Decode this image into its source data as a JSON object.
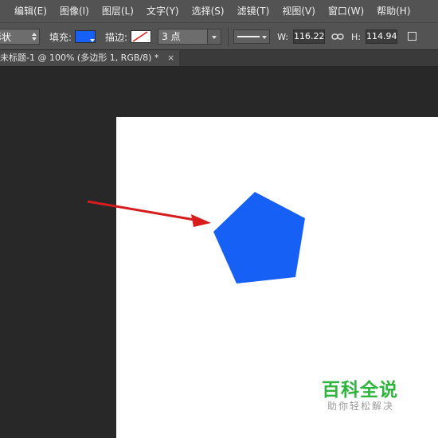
{
  "menu": {
    "items": [
      {
        "label": "编辑(E)"
      },
      {
        "label": "图像(I)"
      },
      {
        "label": "图层(L)"
      },
      {
        "label": "文字(Y)"
      },
      {
        "label": "选择(S)"
      },
      {
        "label": "滤镜(T)"
      },
      {
        "label": "视图(V)"
      },
      {
        "label": "窗口(W)"
      },
      {
        "label": "帮助(H)"
      }
    ]
  },
  "options": {
    "mode_value": "形状",
    "fill_label": "填充:",
    "fill_color": "#1760f5",
    "stroke_label": "描边:",
    "stroke_color": "none",
    "stroke_size": "3 点",
    "width_label": "W:",
    "width_value": "116.22",
    "height_label": "H:",
    "height_value": "114.94"
  },
  "document": {
    "tab_title": "未标题-1 @ 100% (多边形 1, RGB/8) *",
    "close_glyph": "×"
  },
  "canvas": {
    "background": "#ffffff",
    "shape": {
      "type": "pentagon",
      "color": "#1760f5"
    },
    "annotation_arrow_color": "#d61c1c"
  },
  "watermark": {
    "title": "百科全说",
    "subtitle": "助你轻松解决",
    "color": "#2db53c"
  }
}
